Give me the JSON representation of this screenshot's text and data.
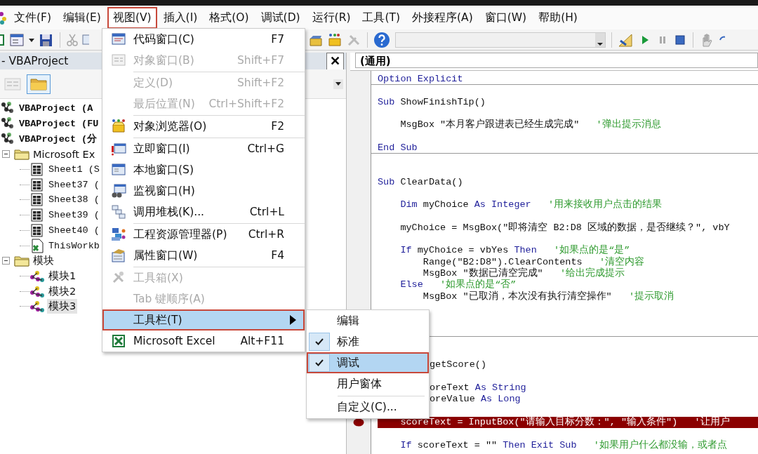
{
  "menubar": [
    {
      "label": "文件(F)",
      "selected": false
    },
    {
      "label": "编辑(E)",
      "selected": false
    },
    {
      "label": "视图(V)",
      "selected": true
    },
    {
      "label": "插入(I)",
      "selected": false
    },
    {
      "label": "格式(O)",
      "selected": false
    },
    {
      "label": "调试(D)",
      "selected": false
    },
    {
      "label": "运行(R)",
      "selected": false
    },
    {
      "label": "工具(T)",
      "selected": false
    },
    {
      "label": "外接程序(A)",
      "selected": false
    },
    {
      "label": "窗口(W)",
      "selected": false
    },
    {
      "label": "帮助(H)",
      "selected": false
    }
  ],
  "project_pane": {
    "title": "- VBAProject",
    "close": "✕",
    "tree": [
      {
        "kind": "project",
        "label": "VBAProject (A",
        "selected": false
      },
      {
        "kind": "project",
        "label": "VBAProject (FU",
        "selected": false
      },
      {
        "kind": "project",
        "label": "VBAProject (分",
        "selected": false,
        "children": [
          {
            "kind": "folder",
            "label": "Microsoft Ex",
            "expanded": true,
            "selected": false,
            "children": [
              {
                "kind": "sheet",
                "label": "Sheet1 (S",
                "selected": false
              },
              {
                "kind": "sheet",
                "label": "Sheet37 (",
                "selected": false
              },
              {
                "kind": "sheet",
                "label": "Sheet38 (",
                "selected": false
              },
              {
                "kind": "sheet",
                "label": "Sheet39 (",
                "selected": false
              },
              {
                "kind": "sheet",
                "label": "Sheet40 (",
                "selected": false
              },
              {
                "kind": "workbook",
                "label": "ThisWorkb",
                "selected": false
              }
            ]
          },
          {
            "kind": "folder",
            "label": "模块",
            "expanded": true,
            "selected": false,
            "children": [
              {
                "kind": "module",
                "label": "模块1",
                "selected": false
              },
              {
                "kind": "module",
                "label": "模块2",
                "selected": false
              },
              {
                "kind": "module",
                "label": "模块3",
                "selected": true
              }
            ]
          }
        ]
      }
    ]
  },
  "code_pane": {
    "object": "(通用)",
    "lines": [
      {
        "kind": "top",
        "segments": [
          {
            "kind": "keyword",
            "text": "Option Explicit"
          }
        ]
      },
      {
        "kind": "separator"
      },
      {
        "kind": "blank"
      },
      {
        "kind": "top",
        "segments": [
          {
            "kind": "keyword",
            "text": "Sub"
          },
          {
            "kind": "plain",
            "text": "ShowFinishTip()"
          }
        ]
      },
      {
        "kind": "blank"
      },
      {
        "kind": "body",
        "segments": [
          {
            "kind": "plain",
            "text": "MsgBox \"本月客户跟进表已经生成完成\""
          },
          {
            "kind": "comment",
            "text": "'弹出提示消息"
          }
        ]
      },
      {
        "kind": "blank"
      },
      {
        "kind": "top",
        "segments": [
          {
            "kind": "keyword",
            "text": "End Sub"
          }
        ]
      },
      {
        "kind": "separator"
      },
      {
        "kind": "blank"
      },
      {
        "kind": "blank"
      },
      {
        "kind": "top",
        "segments": [
          {
            "kind": "keyword",
            "text": "Sub"
          },
          {
            "kind": "plain",
            "text": "ClearData()"
          }
        ]
      },
      {
        "kind": "blank"
      },
      {
        "kind": "body",
        "segments": [
          {
            "kind": "keyword",
            "text": "Dim"
          },
          {
            "kind": "plain",
            "text": "myChoice"
          },
          {
            "kind": "keyword",
            "text": "As Integer"
          },
          {
            "kind": "comment",
            "text": "'用来接收用户点击的结果"
          }
        ]
      },
      {
        "kind": "blank"
      },
      {
        "kind": "body",
        "segments": [
          {
            "kind": "plain",
            "text": "myChoice = MsgBox(\"即将清空 B2:D8 区域的数据，是否继续？\", vbY"
          }
        ]
      },
      {
        "kind": "blank"
      },
      {
        "kind": "body",
        "segments": [
          {
            "kind": "keyword",
            "text": "If"
          },
          {
            "kind": "plain",
            "text": "myChoice = vbYes"
          },
          {
            "kind": "keyword",
            "text": "Then"
          },
          {
            "kind": "comment",
            "text": "'如果点的是“是”"
          }
        ]
      },
      {
        "kind": "inner",
        "segments": [
          {
            "kind": "plain",
            "text": "Range(\"B2:D8\").ClearContents"
          },
          {
            "kind": "comment",
            "text": "'清空内容"
          }
        ]
      },
      {
        "kind": "inner",
        "segments": [
          {
            "kind": "plain",
            "text": "MsgBox \"数据已清空完成\""
          },
          {
            "kind": "comment",
            "text": "'给出完成提示"
          }
        ]
      },
      {
        "kind": "body",
        "segments": [
          {
            "kind": "keyword",
            "text": "Else"
          },
          {
            "kind": "comment",
            "text": "'如果点的是“否”"
          }
        ]
      },
      {
        "kind": "inner",
        "segments": [
          {
            "kind": "plain",
            "text": "MsgBox \"已取消，本次没有执行清空操作\""
          },
          {
            "kind": "comment",
            "text": "'提示取消"
          }
        ]
      },
      {
        "kind": "blank"
      },
      {
        "kind": "blank"
      },
      {
        "kind": "blank"
      },
      {
        "kind": "separator"
      },
      {
        "kind": "blank"
      },
      {
        "kind": "blank"
      },
      {
        "kind": "clipped",
        "segments": [
          {
            "kind": "plain",
            "text": "getScore()"
          }
        ]
      },
      {
        "kind": "blank"
      },
      {
        "kind": "clipped",
        "segments": [
          {
            "kind": "plain",
            "text": "oreText"
          },
          {
            "kind": "keyword",
            "text": "As String"
          }
        ]
      },
      {
        "kind": "clipped",
        "segments": [
          {
            "kind": "plain",
            "text": "oreValue"
          },
          {
            "kind": "keyword",
            "text": "As Long"
          }
        ]
      },
      {
        "kind": "blank"
      },
      {
        "kind": "body",
        "breakpoint": true,
        "segments": [
          {
            "kind": "plain",
            "text": "scoreText = InputBox(\"请输入目标分数：\", \"输入条件\")"
          },
          {
            "kind": "comment",
            "text": "'让用户"
          }
        ]
      },
      {
        "kind": "blank"
      },
      {
        "kind": "body",
        "segments": [
          {
            "kind": "keyword",
            "text": "If"
          },
          {
            "kind": "plain",
            "text": "scoreText = \"\""
          },
          {
            "kind": "keyword",
            "text": "Then Exit Sub"
          },
          {
            "kind": "comment",
            "text": "'如果用户什么都没输，或者点"
          }
        ]
      }
    ]
  },
  "view_menu": [
    {
      "kind": "item",
      "label": "代码窗口(C)",
      "shortcut": "F7",
      "disabled": false,
      "selected": false
    },
    {
      "kind": "item",
      "label": "对象窗口(B)",
      "shortcut": "Shift+F7",
      "disabled": true,
      "selected": false
    },
    {
      "kind": "separator"
    },
    {
      "kind": "item",
      "label": "定义(D)",
      "shortcut": "Shift+F2",
      "disabled": true,
      "selected": false
    },
    {
      "kind": "item",
      "label": "最后位置(N)",
      "shortcut": "Ctrl+Shift+F2",
      "disabled": true,
      "selected": false
    },
    {
      "kind": "separator"
    },
    {
      "kind": "item",
      "label": "对象浏览器(O)",
      "shortcut": "F2",
      "disabled": false,
      "selected": false
    },
    {
      "kind": "separator"
    },
    {
      "kind": "item",
      "label": "立即窗口(I)",
      "shortcut": "Ctrl+G",
      "disabled": false,
      "selected": false
    },
    {
      "kind": "item",
      "label": "本地窗口(S)",
      "disabled": false,
      "selected": false
    },
    {
      "kind": "item",
      "label": "监视窗口(H)",
      "disabled": false,
      "selected": false
    },
    {
      "kind": "item",
      "label": "调用堆栈(K)...",
      "shortcut": "Ctrl+L",
      "disabled": false,
      "selected": false
    },
    {
      "kind": "separator"
    },
    {
      "kind": "item",
      "label": "工程资源管理器(P)",
      "shortcut": "Ctrl+R",
      "disabled": false,
      "selected": false
    },
    {
      "kind": "item",
      "label": "属性窗口(W)",
      "shortcut": "F4",
      "disabled": false,
      "selected": false
    },
    {
      "kind": "separator"
    },
    {
      "kind": "item",
      "label": "工具箱(X)",
      "disabled": true,
      "selected": false
    },
    {
      "kind": "item",
      "label": "Tab 键顺序(A)",
      "disabled": true,
      "selected": false
    },
    {
      "kind": "submenu",
      "label": "工具栏(T)",
      "disabled": false,
      "selected": true
    },
    {
      "kind": "item",
      "label": "Microsoft Excel",
      "shortcut": "Alt+F11",
      "disabled": false,
      "selected": false
    }
  ],
  "toolbars_submenu": [
    {
      "kind": "item",
      "label": "编辑",
      "checked": false,
      "selected": false
    },
    {
      "kind": "item",
      "label": "标准",
      "checked": true,
      "selected": false
    },
    {
      "kind": "item",
      "label": "调试",
      "checked": true,
      "selected": true
    },
    {
      "kind": "item",
      "label": "用户窗体",
      "checked": false,
      "selected": false
    },
    {
      "kind": "separator"
    },
    {
      "kind": "item",
      "label": "自定义(C)...",
      "checked": false,
      "selected": false
    }
  ]
}
